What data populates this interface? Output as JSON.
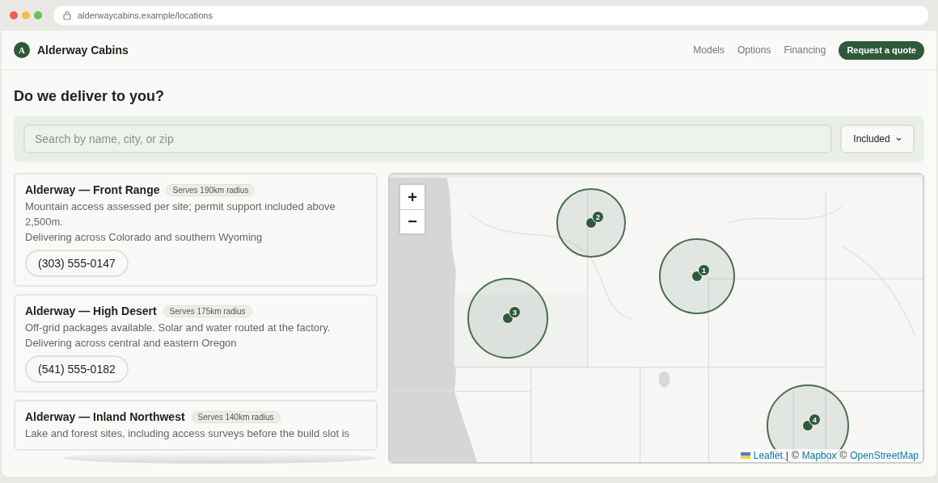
{
  "browser": {
    "url": "alderwaycabins.example/locations"
  },
  "header": {
    "logo_letter": "A",
    "brand": "Alderway Cabins",
    "nav": [
      "Models",
      "Options",
      "Financing"
    ],
    "cta": "Request a quote"
  },
  "heading": "Do we deliver to you?",
  "search": {
    "placeholder": "Search by name, city, or zip",
    "filter": "Included"
  },
  "locations": [
    {
      "name": "Alderway — Front Range",
      "badge": "Serves 190km radius",
      "description": "Mountain access assessed per site; permit support included above 2,500m.",
      "coverage": "Delivering across Colorado and southern Wyoming",
      "phone": "(303) 555-0147"
    },
    {
      "name": "Alderway — High Desert",
      "badge": "Serves 175km radius",
      "description": "Off-grid packages available. Solar and water routed at the factory.",
      "coverage": "Delivering across central and eastern Oregon",
      "phone": "(541) 555-0182"
    },
    {
      "name": "Alderway — Inland Northwest",
      "badge": "Serves 140km radius",
      "description": "Lake and forest sites, including access surveys before the build slot is"
    }
  ],
  "map": {
    "zoom_in": "+",
    "zoom_out": "−",
    "markers": [
      {
        "label": "1"
      },
      {
        "label": "2"
      },
      {
        "label": "3"
      },
      {
        "label": "4"
      }
    ],
    "attribution": {
      "links": [
        "Leaflet",
        "Mapbox",
        "OpenStreetMap"
      ],
      "separator": "|",
      "copyright": "©"
    }
  }
}
